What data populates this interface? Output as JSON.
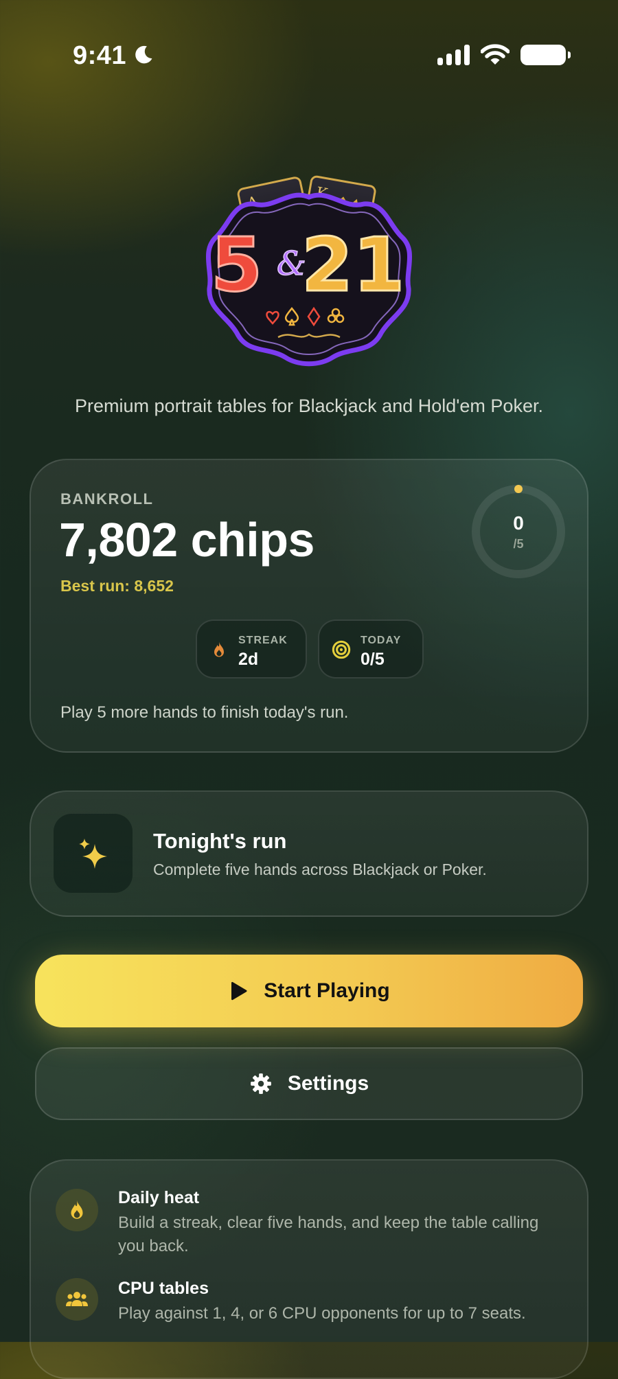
{
  "status_bar": {
    "time": "9:41"
  },
  "brand": {
    "logo_text_left": "5",
    "logo_text_amp": "&",
    "logo_text_right": "21"
  },
  "tagline": "Premium portrait tables for Blackjack and Hold'em Poker.",
  "bankroll": {
    "label": "BANKROLL",
    "value": "7,802 chips",
    "best_run": "Best run: 8,652",
    "progress_value": "0",
    "progress_total": "/5",
    "progress_fraction": 0,
    "streak": {
      "label": "STREAK",
      "value": "2d"
    },
    "today": {
      "label": "TODAY",
      "value": "0/5"
    },
    "hint": "Play 5 more hands to finish today's run."
  },
  "run_card": {
    "title": "Tonight's run",
    "subtitle": "Complete five hands across Blackjack or Poker."
  },
  "actions": {
    "start_label": "Start Playing",
    "settings_label": "Settings"
  },
  "features": [
    {
      "title": "Daily heat",
      "description": "Build a streak, clear five hands, and keep the table calling you back."
    },
    {
      "title": "CPU tables",
      "description": "Play against 1, 4, or 6 CPU opponents for up to 7 seats."
    }
  ],
  "colors": {
    "accent_yellow": "#f7e35c",
    "accent_orange": "#efab42",
    "best_run": "#d9c64b",
    "flame": "#e58b3a"
  },
  "icons": {
    "moon": "moon-icon",
    "signal": "cellular-signal-icon",
    "wifi": "wifi-icon",
    "battery": "battery-icon",
    "flame": "flame-icon",
    "target": "target-icon",
    "sparkle": "sparkle-icon",
    "play": "play-icon",
    "gear": "gear-icon",
    "people": "people-icon"
  }
}
